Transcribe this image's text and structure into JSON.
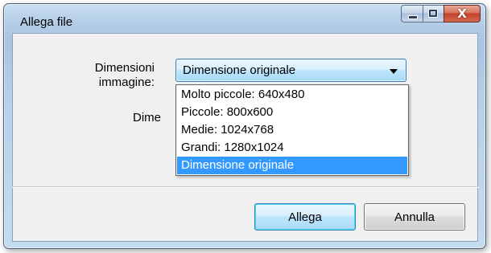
{
  "window": {
    "title": "Allega file",
    "close_glyph": "X"
  },
  "form": {
    "image_size_label": "Dimensioni immagine:",
    "second_label": "Dime",
    "combo_value": "Dimensione originale"
  },
  "dropdown": {
    "options": [
      "Molto piccole: 640x480",
      "Piccole: 800x600",
      "Medie: 1024x768",
      "Grandi: 1280x1024",
      "Dimensione originale"
    ],
    "selected": "Dimensione originale"
  },
  "buttons": {
    "ok": "Allega",
    "cancel": "Annulla"
  },
  "icons": {
    "minimize": "minimize-icon",
    "maximize": "maximize-icon",
    "close": "close-icon",
    "dropdown": "chevron-down-icon"
  },
  "colors": {
    "selection": "#3399ff",
    "close_button": "#c2412a",
    "accent_border": "#3c7fb1"
  }
}
